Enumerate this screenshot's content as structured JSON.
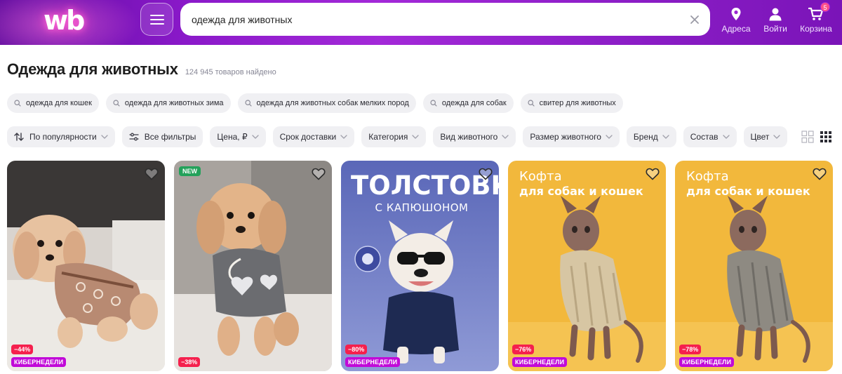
{
  "header": {
    "logo_text": "wb",
    "search_value": "одежда для животных",
    "actions": [
      {
        "icon": "location-pin-icon",
        "label": "Адреса"
      },
      {
        "icon": "user-icon",
        "label": "Войти"
      },
      {
        "icon": "cart-icon",
        "label": "Корзина",
        "badge": "5"
      }
    ],
    "colors": {
      "gradient_start": "#5d0a9e",
      "gradient_mid": "#a329d8",
      "accent": "#cb11ab"
    }
  },
  "page": {
    "title": "Одежда для животных",
    "found": "124 945 товаров найдено"
  },
  "suggestions": [
    "одежда для кошек",
    "одежда для животных зима",
    "одежда для животных собак мелких пород",
    "одежда для собак",
    "свитер для животных"
  ],
  "filters": {
    "sort": "По популярности",
    "all_filters": "Все фильтры",
    "items": [
      "Цена, ₽",
      "Срок доставки",
      "Категория",
      "Вид животного",
      "Размер животного",
      "Бренд",
      "Состав",
      "Цвет"
    ]
  },
  "view_modes": [
    "grid-large-icon",
    "grid-small-icon"
  ],
  "products": [
    {
      "discount": "−44%",
      "badge": "КИБЕРНЕДЕЛИ",
      "new": "",
      "poster_title": "",
      "poster_subtitle": ""
    },
    {
      "discount": "−38%",
      "badge": "",
      "new": "NEW",
      "poster_title": "",
      "poster_subtitle": ""
    },
    {
      "discount": "−80%",
      "badge": "КИБЕРНЕДЕЛИ",
      "new": "",
      "poster_title": "ТОЛСТОВКА",
      "poster_subtitle": "С КАПЮШОНОМ"
    },
    {
      "discount": "−76%",
      "badge": "КИБЕРНЕДЕЛИ",
      "new": "",
      "poster_title": "Кофта",
      "poster_subtitle": "для собак и кошек"
    },
    {
      "discount": "−78%",
      "badge": "КИБЕРНЕДЕЛИ",
      "new": "",
      "poster_title": "Кофта",
      "poster_subtitle": "для собак и кошек"
    }
  ]
}
